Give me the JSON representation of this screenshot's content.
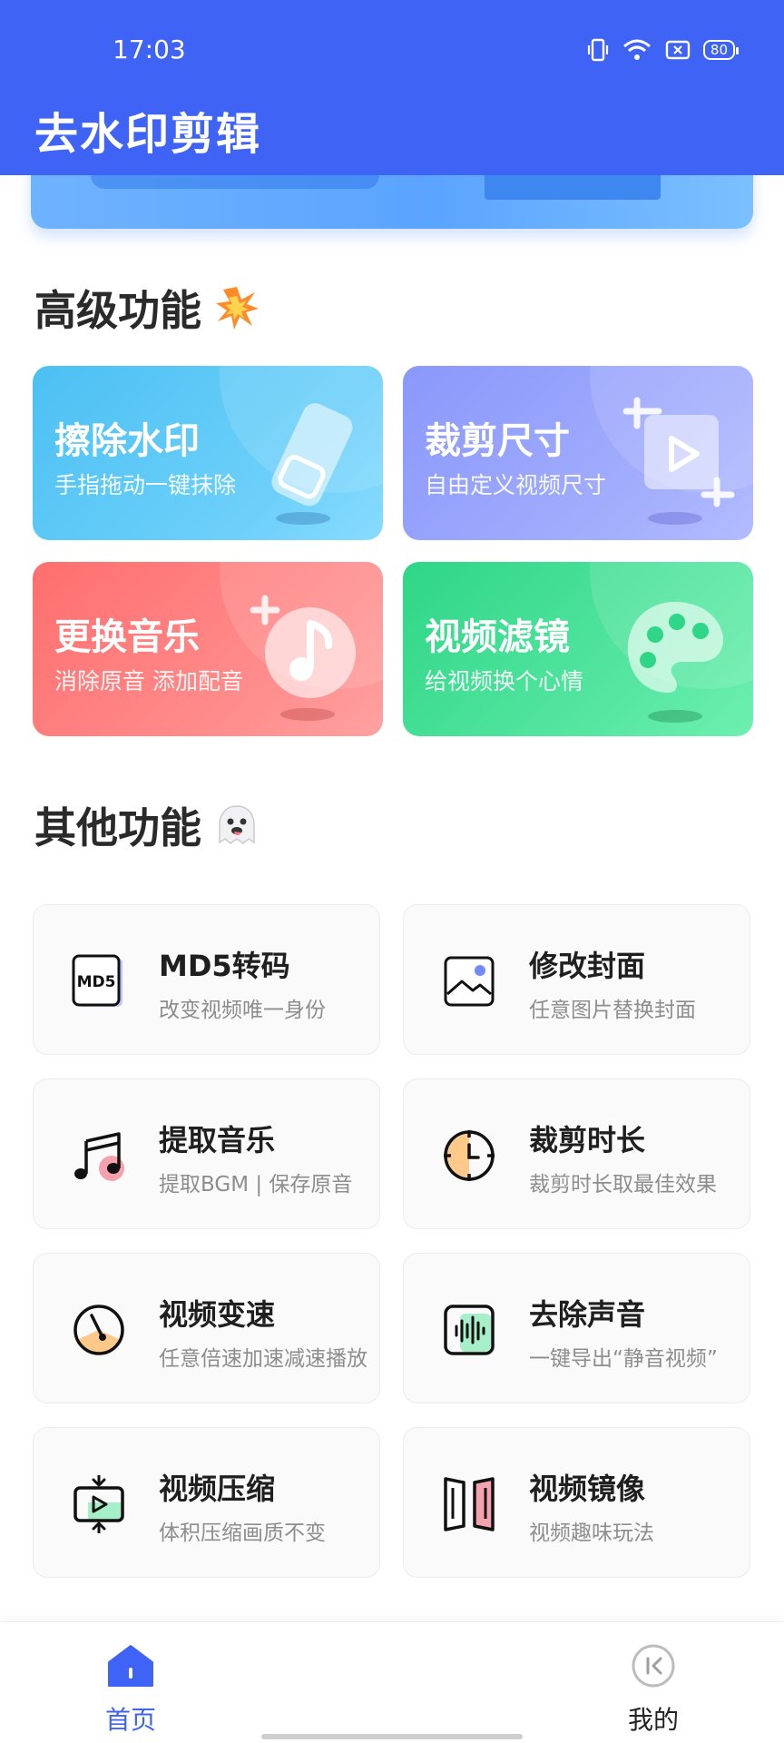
{
  "status_bar": {
    "time": "17:03",
    "battery": "80"
  },
  "app": {
    "title": "去水印剪辑"
  },
  "sections": {
    "advanced_title": "高级功能",
    "other_title": "其他功能"
  },
  "features": [
    {
      "title": "擦除水印",
      "subtitle": "手指拖动一键抹除"
    },
    {
      "title": "裁剪尺寸",
      "subtitle": "自由定义视频尺寸"
    },
    {
      "title": "更换音乐",
      "subtitle": "消除原音 添加配音"
    },
    {
      "title": "视频滤镜",
      "subtitle": "给视频换个心情"
    }
  ],
  "tools": [
    {
      "title": "MD5转码",
      "subtitle": "改变视频唯一身份",
      "icon": "md5-icon"
    },
    {
      "title": "修改封面",
      "subtitle": "任意图片替换封面",
      "icon": "image-icon"
    },
    {
      "title": "提取音乐",
      "subtitle": "提取BGM | 保存原音",
      "icon": "music-note-icon"
    },
    {
      "title": "裁剪时长",
      "subtitle": "裁剪时长取最佳效果",
      "icon": "clock-icon"
    },
    {
      "title": "视频变速",
      "subtitle": "任意倍速加速减速播放",
      "icon": "speedometer-icon"
    },
    {
      "title": "去除声音",
      "subtitle": "一键导出“静音视频”",
      "icon": "waveform-icon"
    },
    {
      "title": "视频压缩",
      "subtitle": "体积压缩画质不变",
      "icon": "compress-icon"
    },
    {
      "title": "视频镜像",
      "subtitle": "视频趣味玩法",
      "icon": "mirror-icon"
    }
  ],
  "nav": {
    "home": "首页",
    "mine": "我的"
  },
  "colors": {
    "primary": "#3E63F5",
    "feature_blue": "#4CC0F2",
    "feature_purple": "#8A98FB",
    "feature_red": "#FF6E6E",
    "feature_green": "#2FD687"
  }
}
